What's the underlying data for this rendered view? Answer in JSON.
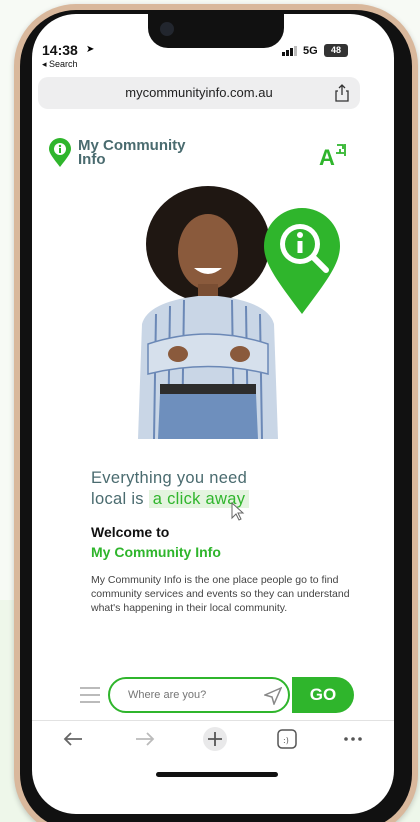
{
  "status_bar": {
    "time": "14:38",
    "back_app": "◂ Search",
    "network": "5G",
    "battery": "48"
  },
  "browser": {
    "url": "mycommunityinfo.com.au"
  },
  "site": {
    "logo_line1": "My Community",
    "logo_line2": "Info",
    "lang_icon": "translate-icon",
    "headline_line1": "Everything you need",
    "headline_line2_prefix": "local is",
    "headline_highlight": "a click away",
    "welcome_line1": "Welcome to",
    "welcome_line2": "My Community Info",
    "description": "My Community Info is the one place people go to find community services and events so they can understand what's happening in their local community.",
    "search_placeholder": "Where are you?",
    "go_label": "GO"
  },
  "colors": {
    "brand_green": "#2fb52c",
    "text_teal": "#4a6b6f",
    "highlight": "#e4f4df"
  }
}
